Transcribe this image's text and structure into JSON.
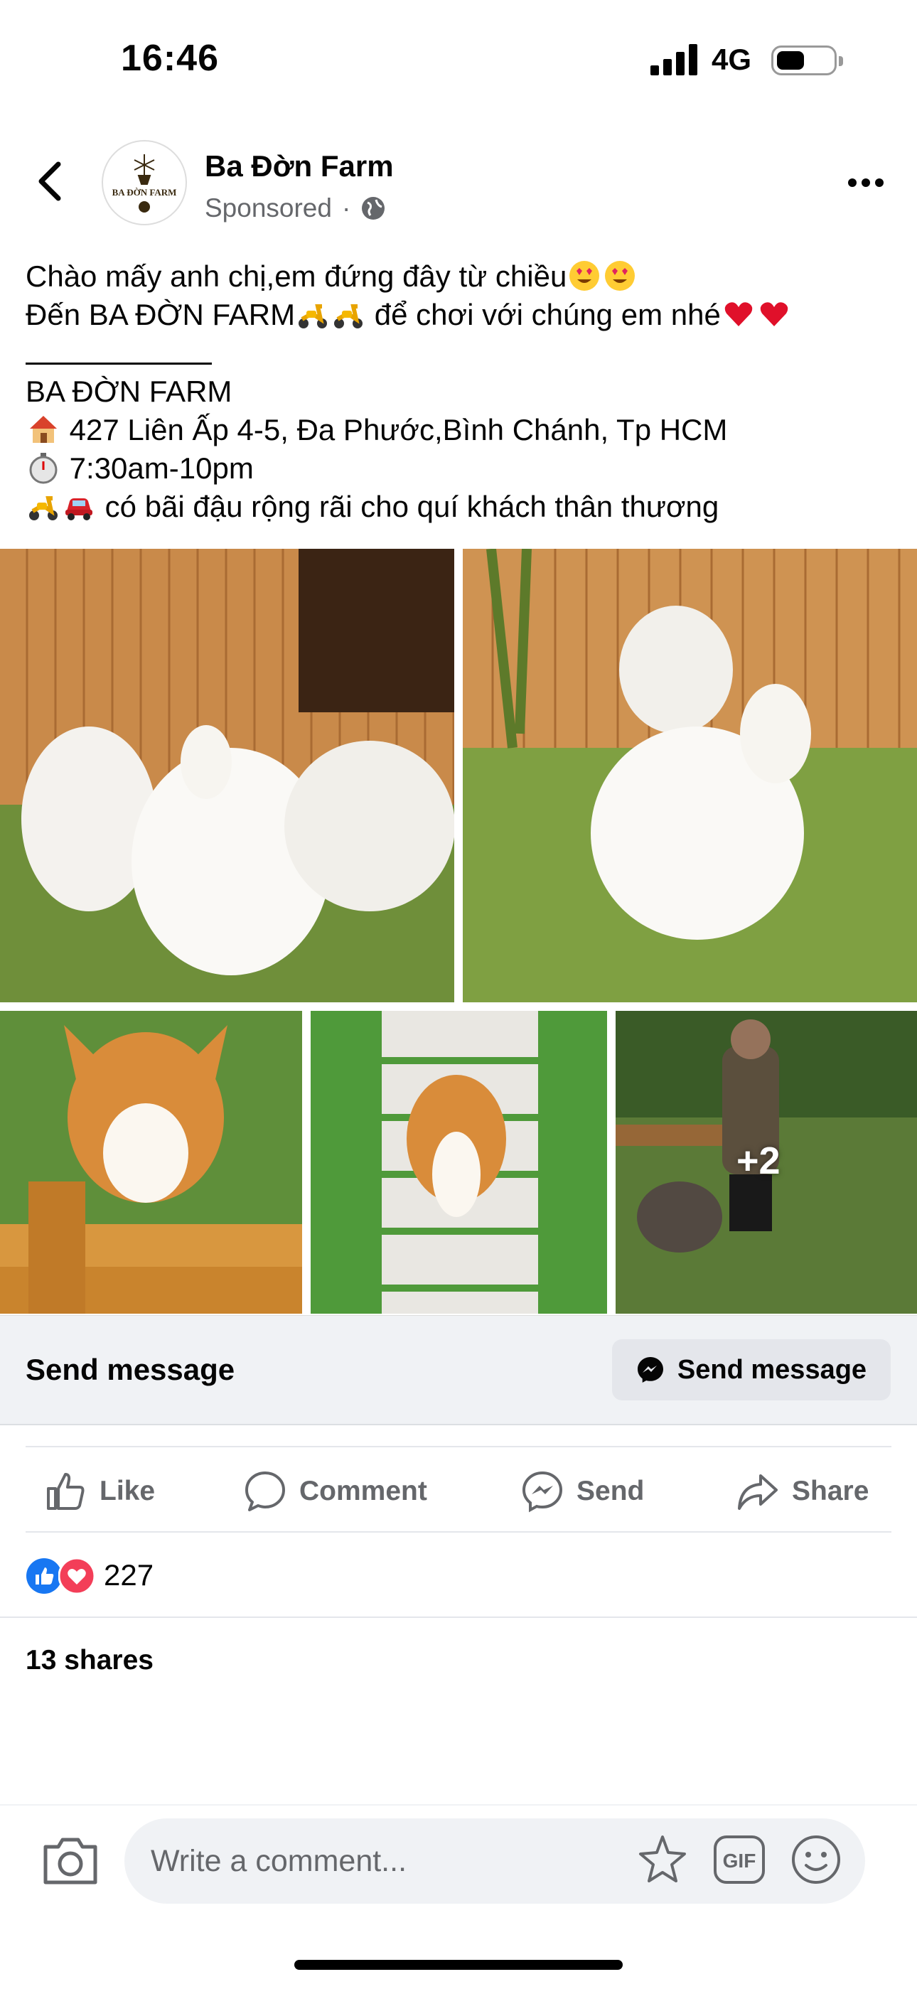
{
  "status_bar": {
    "time": "16:46",
    "network": "4G"
  },
  "header": {
    "page_name": "Ba Đờn Farm",
    "sponsored": "Sponsored",
    "separator": "·",
    "avatar_logo_text": "BA ĐỜN FARM"
  },
  "post": {
    "line1": "Chào mấy anh chị,em đứng đây từ chiều",
    "line2a": "Đến BA ĐỜN FARM",
    "line2b": " để chơi với chúng em nhé",
    "brand_line": "BA ĐỜN FARM",
    "address": "427 Liên Ấp 4-5, Đa Phước,Bình Chánh, Tp HCM",
    "hours": "7:30am-10pm",
    "parking": "có bãi đậu rộng rãi cho quí khách thân thương"
  },
  "photos": {
    "more_count": "+2"
  },
  "send_message": {
    "label": "Send message",
    "button": "Send message"
  },
  "actions": {
    "like": "Like",
    "comment": "Comment",
    "send": "Send",
    "share": "Share"
  },
  "reactions": {
    "count": "227"
  },
  "shares": {
    "text": "13 shares"
  },
  "comment_bar": {
    "placeholder": "Write a comment..."
  },
  "colors": {
    "facebook_blue": "#1877f2",
    "love_red": "#f33e58",
    "muted": "#65676b",
    "bar_bg": "#f0f2f5"
  }
}
